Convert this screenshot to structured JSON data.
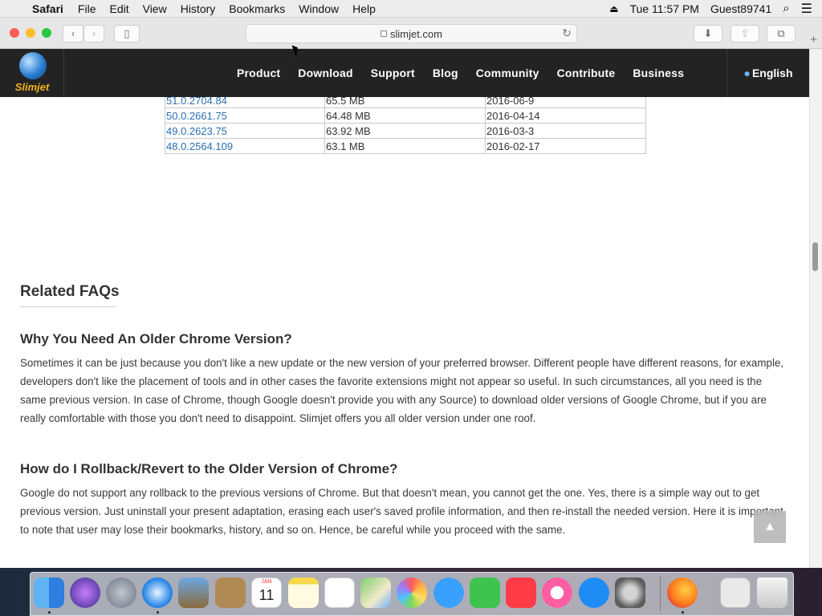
{
  "menubar": {
    "app": "Safari",
    "items": [
      "File",
      "Edit",
      "View",
      "History",
      "Bookmarks",
      "Window",
      "Help"
    ],
    "clock": "Tue 11:57 PM",
    "user": "Guest89741"
  },
  "browser": {
    "url": "slimjet.com"
  },
  "site": {
    "logo_text": "Slimjet",
    "nav": [
      "Product",
      "Download",
      "Support",
      "Blog",
      "Community",
      "Contribute",
      "Business"
    ],
    "language": "English"
  },
  "versions_table": {
    "rows": [
      {
        "version": "51.0.2704.84",
        "size": "65.5 MB",
        "date": "2016-06-9"
      },
      {
        "version": "50.0.2661.75",
        "size": "64.48 MB",
        "date": "2016-04-14"
      },
      {
        "version": "49.0.2623.75",
        "size": "63.92 MB",
        "date": "2016-03-3"
      },
      {
        "version": "48.0.2564.109",
        "size": "63.1 MB",
        "date": "2016-02-17"
      }
    ]
  },
  "faq": {
    "heading": "Related FAQs",
    "items": [
      {
        "question": "Why You Need An Older Chrome Version?",
        "answer": "Sometimes it can be just because you don't like a new update or the new version of your preferred browser. Different people have different reasons, for example, developers don't like the placement of tools and in other cases the favorite extensions might not appear so useful. In such circumstances, all you need is the same previous version. In case of Chrome, though Google doesn't provide you with any Source) to download older versions of Google Chrome, but if you are really comfortable with those you don't need to disappoint. Slimjet offers you all older version under one roof."
      },
      {
        "question": "How do I Rollback/Revert to the Older Version of Chrome?",
        "answer": "Google do not support any rollback to the previous versions of Chrome. But that doesn't mean, you cannot get the one. Yes, there is a simple way out to get previous version. Just uninstall your present adaptation, erasing each user's saved profile information, and then re-install the needed version. Here it is important to note that user may lose their bookmarks, history, and so on. Hence, be careful while you proceed with the same."
      }
    ]
  },
  "dock": {
    "calendar_month": "JAN",
    "calendar_day": "11",
    "icons": [
      "finder-icon",
      "siri-icon",
      "launchpad-icon",
      "safari-icon",
      "preview-icon",
      "contacts-icon",
      "calendar-icon",
      "notes-icon",
      "reminders-icon",
      "maps-icon",
      "photos-icon",
      "messages-icon",
      "facetime-icon",
      "news-icon",
      "music-icon",
      "app-store-icon",
      "system-preferences-icon",
      "firefox-icon",
      "downloads-stack-icon",
      "trash-icon"
    ]
  },
  "colors": {
    "site_header": "#232323",
    "link": "#2a6fb0",
    "logo_text": "#f1b31c"
  }
}
